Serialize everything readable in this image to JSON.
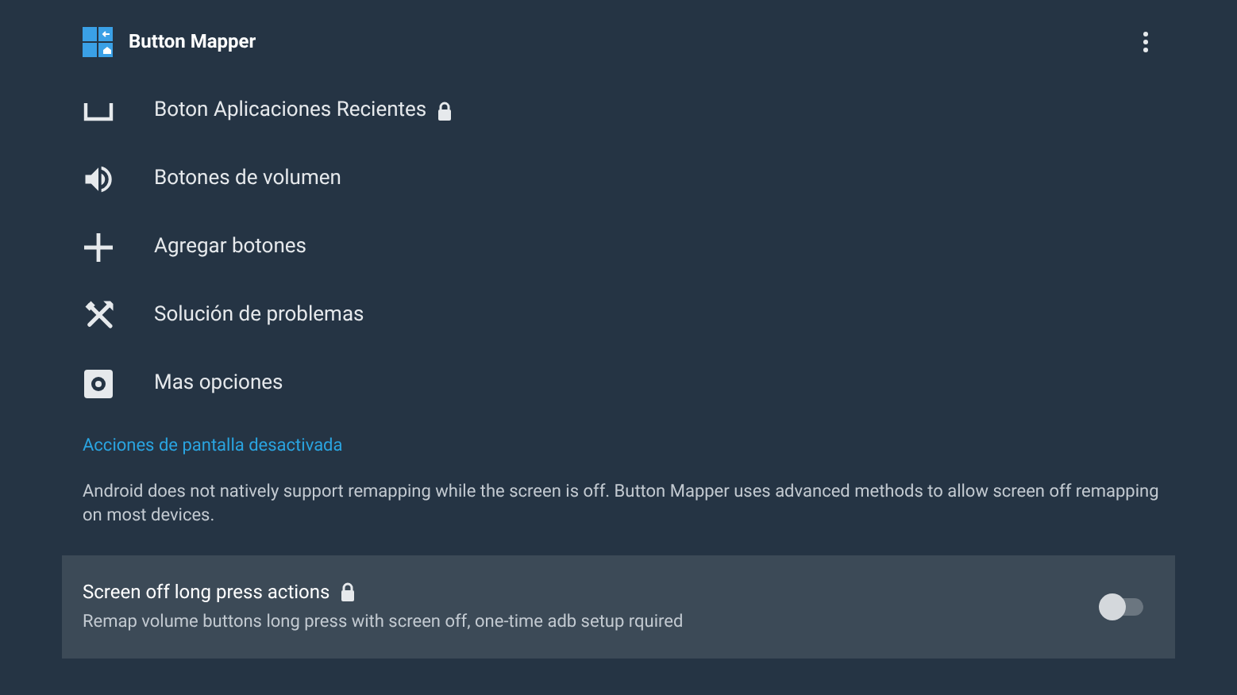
{
  "app_bar": {
    "title": "Button Mapper"
  },
  "menu_items": [
    {
      "kind": "recents",
      "label": "Boton Aplicaciones Recientes",
      "locked": true
    },
    {
      "kind": "volume",
      "label": "Botones de volumen",
      "locked": false
    },
    {
      "kind": "add",
      "label": "Agregar botones",
      "locked": false
    },
    {
      "kind": "tools",
      "label": "Solución de problemas",
      "locked": false
    },
    {
      "kind": "settings",
      "label": "Mas opciones",
      "locked": false
    }
  ],
  "section": {
    "heading": "Acciones de pantalla desactivada",
    "description": "Android does not natively support remapping while the screen is off. Button Mapper uses advanced methods to allow screen off remapping on most devices."
  },
  "setting": {
    "title": "Screen off long press actions",
    "locked": true,
    "subtitle": "Remap volume buttons long press with screen off, one-time adb setup rquired",
    "on": false
  }
}
